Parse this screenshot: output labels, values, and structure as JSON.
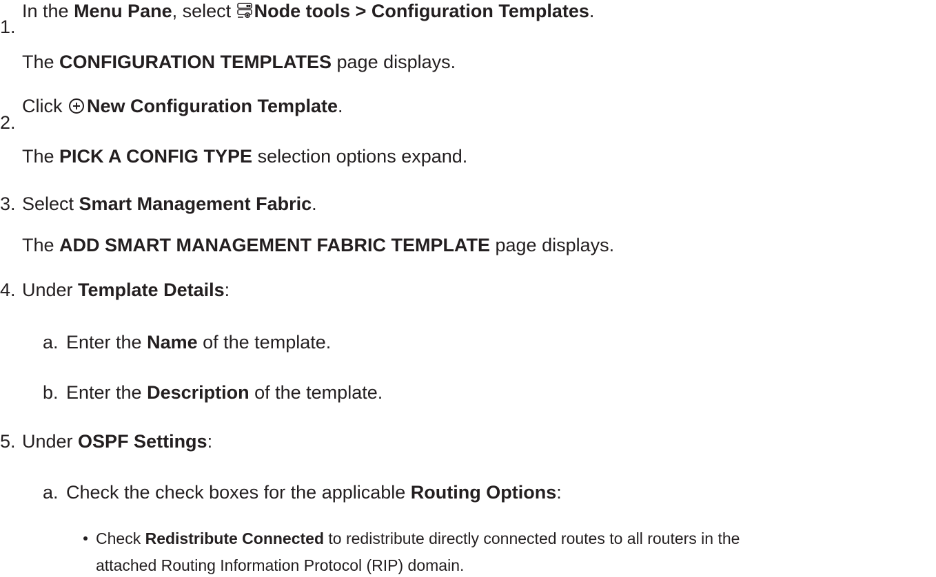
{
  "steps": [
    {
      "num": "1.",
      "parts": {
        "t1": "In the ",
        "b1": "Menu Pane",
        "t2": ", select ",
        "b2": "Node tools > Configuration Templates",
        "t3": "."
      },
      "icon": "node-tools-icon",
      "result": {
        "t1": "The ",
        "b1": "CONFIGURATION TEMPLATES",
        "t2": " page displays."
      }
    },
    {
      "num": "2.",
      "parts": {
        "t1": "Click ",
        "b1": "New Configuration Template",
        "t2": "."
      },
      "icon": "plus-circle-icon",
      "result": {
        "t1": "The ",
        "b1": "PICK A CONFIG TYPE",
        "t2": " selection options expand."
      }
    },
    {
      "num": "3.",
      "parts": {
        "t1": "Select ",
        "b1": "Smart Management Fabric",
        "t2": "."
      },
      "result": {
        "t1": "The ",
        "b1": "ADD SMART MANAGEMENT FABRIC TEMPLATE",
        "t2": " page displays."
      }
    },
    {
      "num": "4.",
      "parts": {
        "t1": "Under ",
        "b1": "Template Details",
        "t2": ":"
      },
      "sub": [
        {
          "letter": "a.",
          "t1": "Enter the ",
          "b1": "Name",
          "t2": " of the template."
        },
        {
          "letter": "b.",
          "t1": "Enter the ",
          "b1": "Description",
          "t2": " of the template."
        }
      ]
    },
    {
      "num": "5.",
      "parts": {
        "t1": "Under ",
        "b1": "OSPF Settings",
        "t2": ":"
      },
      "sub": [
        {
          "letter": "a.",
          "t1": "Check the check boxes for the applicable ",
          "b1": "Routing Options",
          "t2": ":"
        }
      ],
      "bullet": {
        "t1": "Check ",
        "b1": "Redistribute Connected",
        "t2": " to redistribute directly connected routes to all routers in the",
        "t3": "attached Routing Information Protocol (RIP) domain."
      }
    }
  ]
}
